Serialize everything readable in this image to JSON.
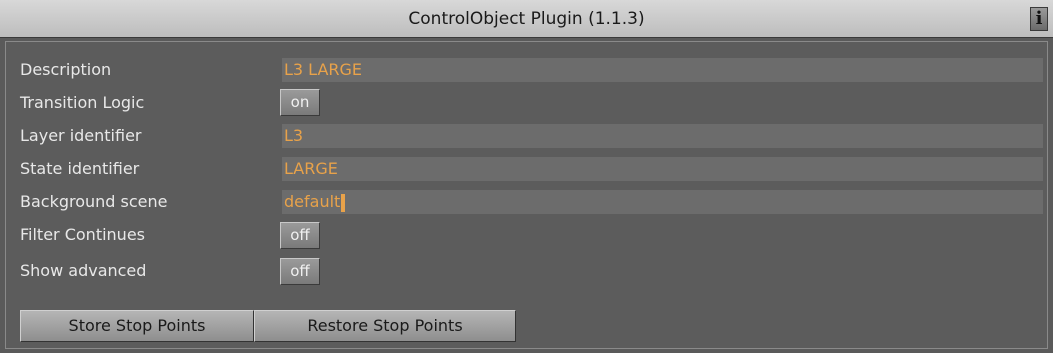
{
  "window": {
    "title": "ControlObject Plugin (1.1.3)",
    "info_icon": "i"
  },
  "fields": {
    "description": {
      "label": "Description",
      "value": "L3 LARGE"
    },
    "transition_logic": {
      "label": "Transition Logic",
      "value": "on"
    },
    "layer_identifier": {
      "label": "Layer identifier",
      "value": "L3"
    },
    "state_identifier": {
      "label": "State identifier",
      "value": "LARGE"
    },
    "background_scene": {
      "label": "Background scene",
      "value": "default"
    },
    "filter_continues": {
      "label": "Filter Continues",
      "value": "off"
    },
    "show_advanced": {
      "label": "Show advanced",
      "value": "off"
    }
  },
  "buttons": {
    "store": "Store Stop Points",
    "restore": "Restore Stop Points"
  },
  "colors": {
    "background": "#5a5a5a",
    "field_bg": "#6c6c6c",
    "field_text": "#e8a24a",
    "label_text": "#e8e8e8"
  }
}
